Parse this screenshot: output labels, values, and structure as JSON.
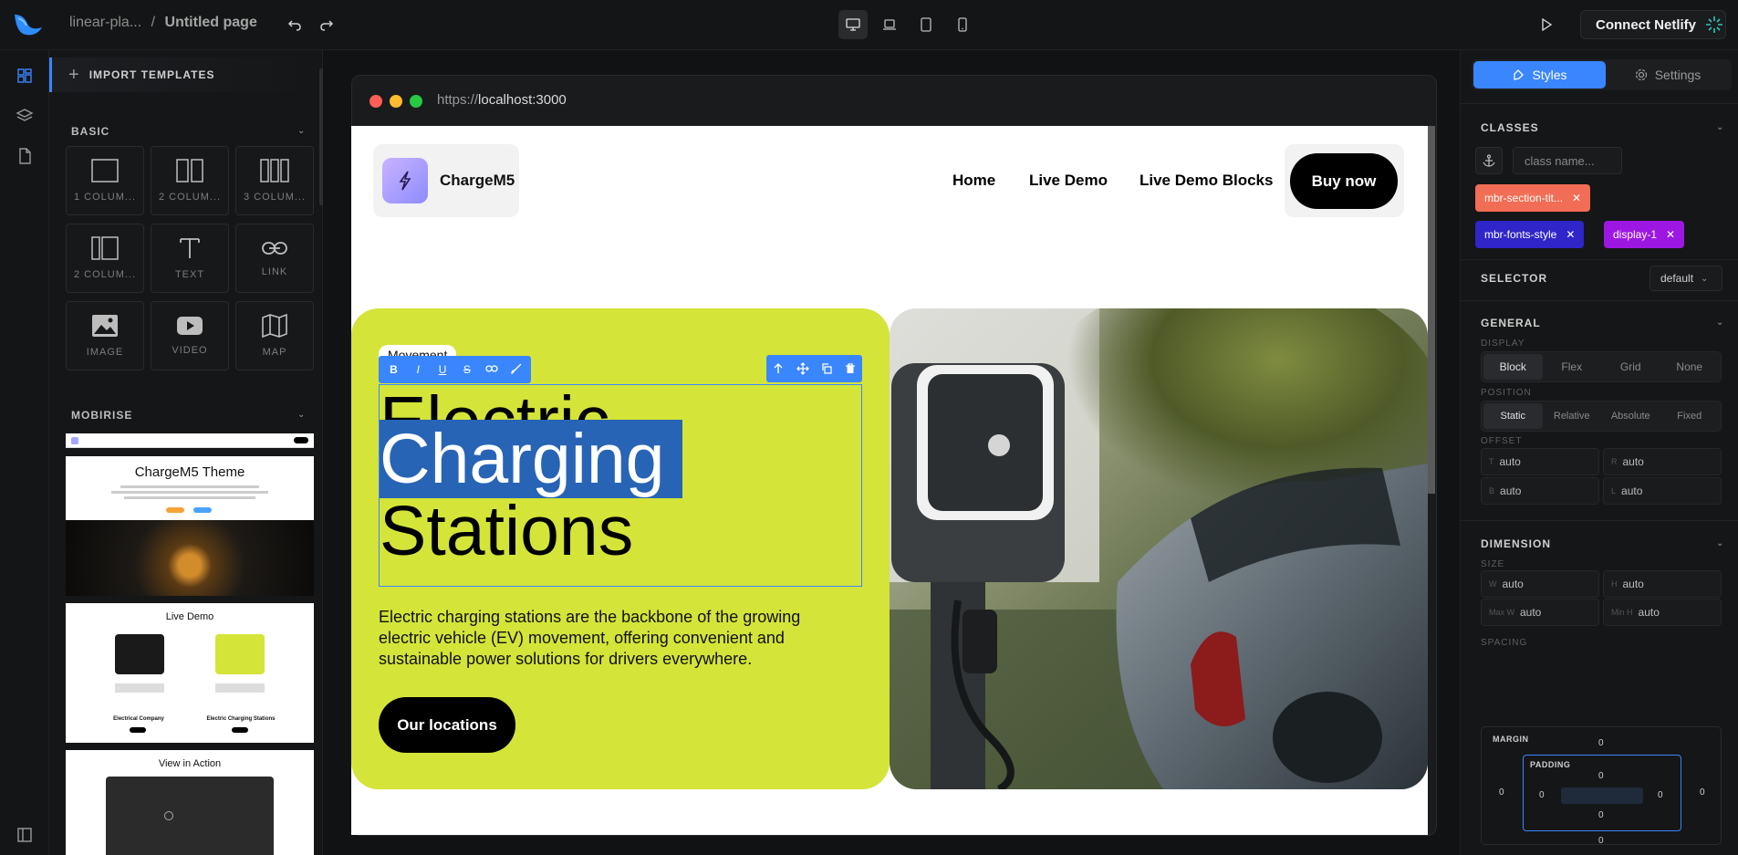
{
  "topbar": {
    "project": "linear-pla...",
    "separator": "/",
    "page": "Untitled page",
    "connect_label": "Connect Netlify"
  },
  "left_panel": {
    "import_label": "IMPORT TEMPLATES",
    "basic_title": "BASIC",
    "tiles": [
      {
        "label": "1 COLUM...",
        "icon": "one-column-icon"
      },
      {
        "label": "2 COLUM...",
        "icon": "two-columns-icon"
      },
      {
        "label": "3 COLUM...",
        "icon": "three-columns-icon"
      },
      {
        "label": "2 COLUM...",
        "icon": "two-columns-uneven-icon"
      },
      {
        "label": "TEXT",
        "icon": "text-icon"
      },
      {
        "label": "LINK",
        "icon": "link-icon"
      },
      {
        "label": "IMAGE",
        "icon": "image-icon"
      },
      {
        "label": "VIDEO",
        "icon": "video-icon"
      },
      {
        "label": "MAP",
        "icon": "map-icon"
      }
    ],
    "mobirise_title": "MOBIRISE",
    "templates": [
      {
        "title": "ChargeM5 Theme"
      },
      {
        "title": "Live Demo",
        "captions": [
          "Electrical Company",
          "Electric Charging Stations"
        ]
      },
      {
        "title": "View in Action"
      }
    ]
  },
  "browser": {
    "url_prefix": "https://",
    "url_host": "localhost:3000"
  },
  "site": {
    "brand": "ChargeM5",
    "nav": [
      "Home",
      "Live Demo",
      "Live Demo Blocks"
    ],
    "buy": "Buy now",
    "badge": "Movement",
    "heading": [
      "Electric",
      "Charging",
      "Stations"
    ],
    "description": "Electric charging stations are the backbone of the growing electric vehicle (EV) movement, offering convenient and sustainable power solutions for drivers everywhere.",
    "cta": "Our locations",
    "rte_buttons": [
      "B",
      "I",
      "U",
      "S"
    ]
  },
  "right_panel": {
    "tabs": [
      "Styles",
      "Settings"
    ],
    "classes_title": "CLASSES",
    "class_placeholder": "class name...",
    "chips": [
      {
        "label": "mbr-section-tit...",
        "color": "#f26d55"
      },
      {
        "label": "mbr-fonts-style",
        "color": "#2f25c9"
      },
      {
        "label": "display-1",
        "color": "#9d17e3"
      }
    ],
    "selector_title": "SELECTOR",
    "selector_value": "default",
    "general_title": "GENERAL",
    "display_label": "DISPLAY",
    "display_options": [
      "Block",
      "Flex",
      "Grid",
      "None"
    ],
    "position_label": "POSITION",
    "position_options": [
      "Static",
      "Relative",
      "Absolute",
      "Fixed"
    ],
    "offset_label": "OFFSET",
    "offset": {
      "T": "auto",
      "R": "auto",
      "B": "auto",
      "L": "auto"
    },
    "dimension_title": "DIMENSION",
    "size_label": "SIZE",
    "size": {
      "W": "auto",
      "H": "auto",
      "MaxW": "auto",
      "MinH": "auto"
    },
    "size_prefixes": {
      "W": "W",
      "H": "H",
      "MaxW": "Max W",
      "MinH": "Min H"
    },
    "spacing_label": "SPACING",
    "margin_label": "MARGIN",
    "padding_label": "PADDING",
    "zero": "0"
  }
}
